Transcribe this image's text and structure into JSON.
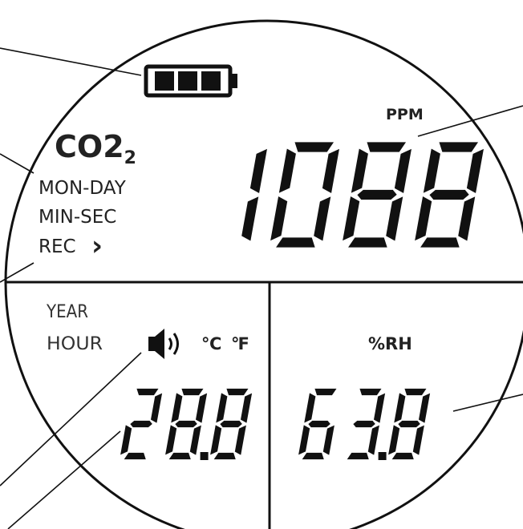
{
  "labels": {
    "co2": "CO2",
    "co2_sub": "2",
    "mon_day": "MON-DAY",
    "min_sec": "MIN-SEC",
    "rec": "REC",
    "rec_arrow": "›",
    "year": "YEAR",
    "hour": "HOUR",
    "ppm": "PPM",
    "celsius": "℃",
    "fahrenheit": "℉",
    "humidity_unit": "%RH"
  },
  "readings": {
    "co2_ppm": "1088",
    "temperature": "28.8",
    "humidity": "63.8"
  },
  "icons": {
    "battery": "battery-full-icon",
    "speaker": "speaker-icon"
  },
  "battery_bars": 3,
  "colors": {
    "ink": "#111111",
    "background": "#ffffff"
  }
}
